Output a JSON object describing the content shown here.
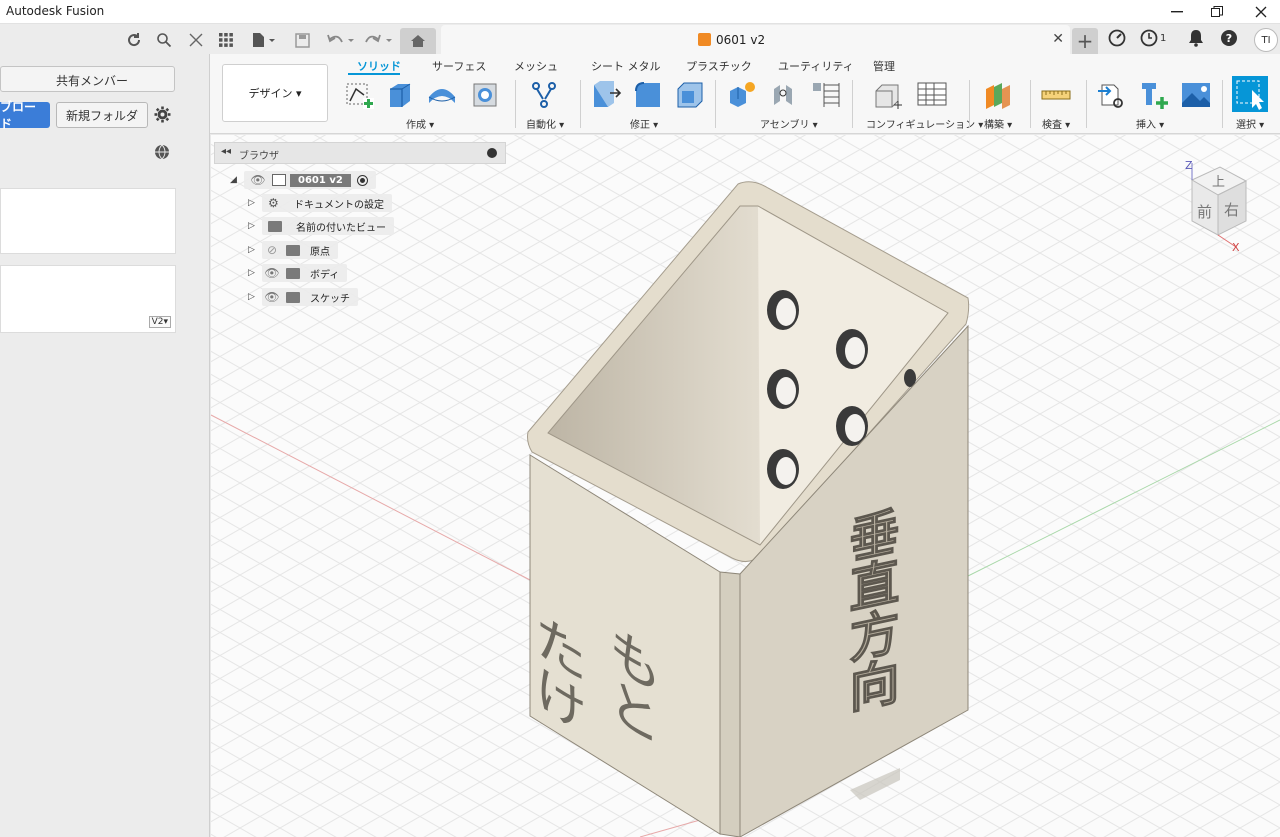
{
  "window": {
    "title": "Autodesk Fusion"
  },
  "document": {
    "tab_title": "0601 v2"
  },
  "toprow": {
    "jobs_count": "1",
    "user_initials": "TI"
  },
  "leftpanel": {
    "tab_label": "共有メンバー",
    "upload_label": "ブロード",
    "new_folder_label": "新規フォルダ",
    "version_badge": "V2▾"
  },
  "ribbon": {
    "workspace_label": "デザイン ▾",
    "tabs": [
      "ソリッド",
      "サーフェス",
      "メッシュ",
      "シート メタル",
      "プラスチック",
      "ユーティリティ",
      "管理"
    ],
    "groups": [
      "作成 ▾",
      "自動化 ▾",
      "修正 ▾",
      "アセンブリ ▾",
      "コンフィギュレーション ▾",
      "構築 ▾",
      "検査 ▾",
      "挿入 ▾",
      "選択 ▾"
    ]
  },
  "browser": {
    "title": "ブラウザ",
    "root_label": "0601 v2",
    "items": [
      "ドキュメントの設定",
      "名前の付いたビュー",
      "原点",
      "ボディ",
      "スケッチ"
    ]
  },
  "viewcube": {
    "top": "上",
    "front": "前",
    "right": "右",
    "axis_z": "Z",
    "axis_x": "X"
  },
  "model": {
    "left_face_text_col1": "たけ",
    "left_face_text_col2": "もと",
    "right_face_text": "垂直方向"
  }
}
